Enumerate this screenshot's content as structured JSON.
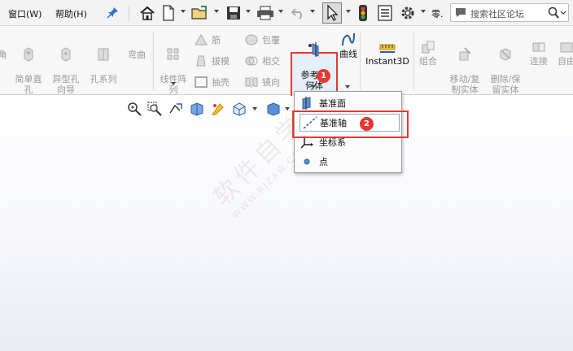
{
  "menu": {
    "window": "窗口(W)",
    "help": "帮助(H)"
  },
  "toolbar": {
    "truncated_label": "零.",
    "search_placeholder": "搜索社区论坛",
    "icons": [
      "home-icon",
      "new-document-icon",
      "open-icon",
      "save-icon",
      "print-icon",
      "undo-icon",
      "select-arrow-icon",
      "traffic-light-icon",
      "file-properties-icon",
      "options-gear-icon"
    ]
  },
  "ribbon": {
    "features": [
      {
        "label": "角"
      },
      {
        "label": "简单直\n孔"
      },
      {
        "label": "异型孔\n向导"
      },
      {
        "label": "孔系列"
      },
      {
        "label": "弯曲"
      },
      {
        "label": "线性阵\n列"
      },
      {
        "label": "筋"
      },
      {
        "label": "拔模"
      },
      {
        "label": "抽壳"
      },
      {
        "label": "包覆"
      },
      {
        "label": "相交"
      },
      {
        "label": "镜向"
      },
      {
        "label": "参考几\n何体"
      },
      {
        "label": "曲线"
      },
      {
        "label": "Instant3D"
      },
      {
        "label": "组合"
      },
      {
        "label": "移动/复\n制实体"
      },
      {
        "label": "删除/保\n留实体"
      },
      {
        "label": "连接"
      },
      {
        "label": "自由"
      }
    ]
  },
  "dropdown": {
    "items": [
      {
        "label": "基准面"
      },
      {
        "label": "基准轴"
      },
      {
        "label": "坐标系"
      },
      {
        "label": "点"
      }
    ]
  },
  "badges": {
    "step1": "1",
    "step2": "2"
  },
  "watermark": {
    "main": "软件自学网",
    "url": "WWW.RJZXW.COM"
  },
  "colors": {
    "highlight_red": "#e53935",
    "ribbon_bg": "#f7f7f7",
    "menu_bg": "#f3f3f3"
  }
}
